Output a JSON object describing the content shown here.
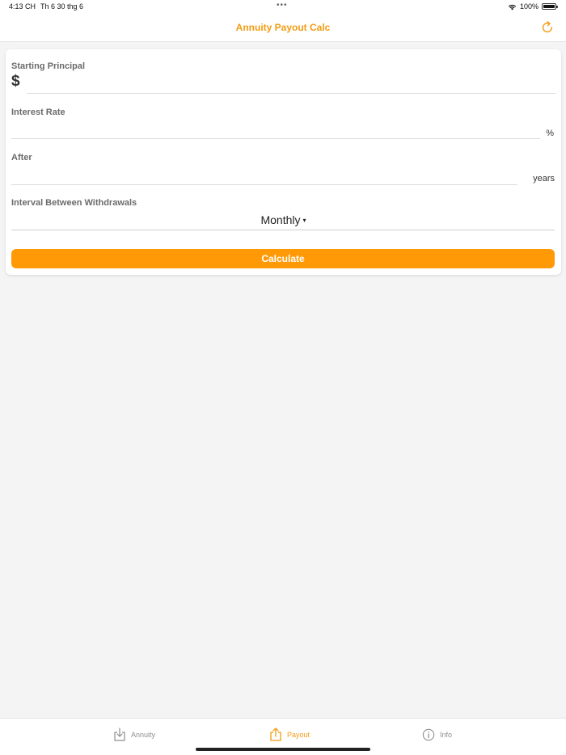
{
  "status_bar": {
    "time": "4:13 CH",
    "date": "Th 6 30 thg 6",
    "dots": "•••",
    "battery": "100%"
  },
  "nav": {
    "title": "Annuity Payout Calc",
    "refresh_icon": "refresh-icon"
  },
  "form": {
    "principal": {
      "label": "Starting Principal",
      "currency": "$",
      "value": ""
    },
    "interest": {
      "label": "Interest Rate",
      "unit": "%",
      "value": ""
    },
    "after": {
      "label": "After",
      "unit": "years",
      "value": ""
    },
    "interval": {
      "label": "Interval Between Withdrawals",
      "selected": "Monthly",
      "caret": "▾"
    },
    "calculate_label": "Calculate"
  },
  "tabs": [
    {
      "label": "Annuity",
      "icon": "download-tray-icon",
      "active": false
    },
    {
      "label": "Payout",
      "icon": "share-upload-icon",
      "active": true
    },
    {
      "label": "Info",
      "icon": "info-circle-icon",
      "active": false
    }
  ],
  "colors": {
    "accent": "#f39c12",
    "button": "#ff9a06",
    "background": "#f4f4f4",
    "inactive_tab": "#8e8e93"
  }
}
